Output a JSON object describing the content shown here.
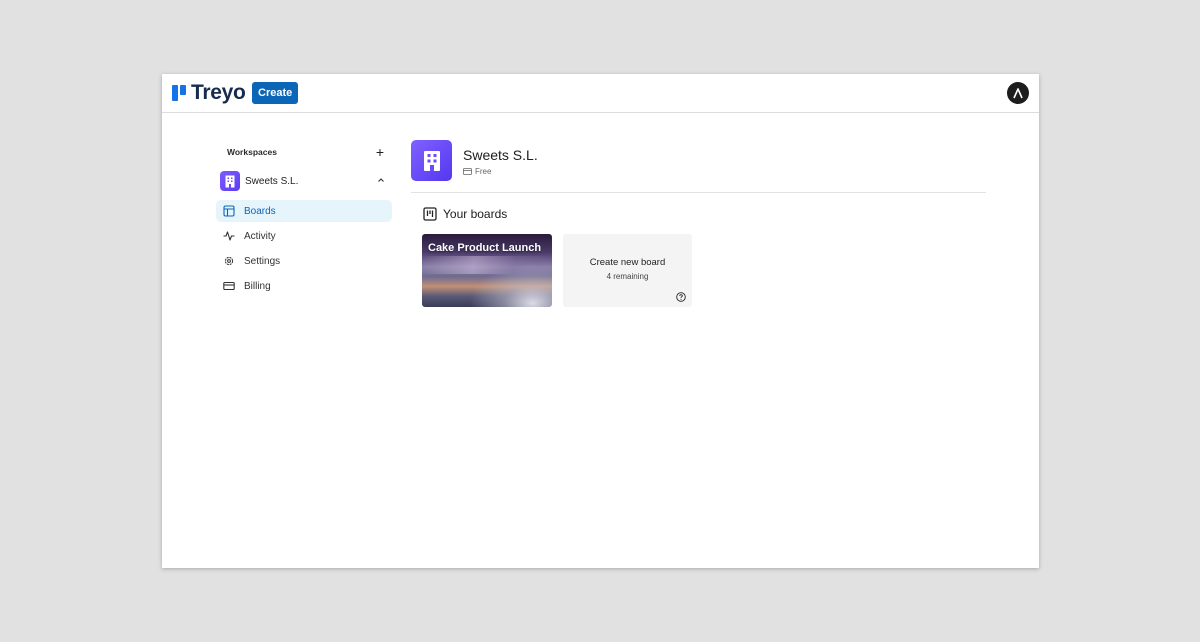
{
  "app": {
    "name": "Treyo",
    "brand_color": "#1473e6"
  },
  "topbar": {
    "create_label": "Create"
  },
  "sidebar": {
    "header_label": "Workspaces",
    "workspace": {
      "name": "Sweets S.L."
    },
    "items": [
      {
        "label": "Boards",
        "icon": "board-icon",
        "active": true
      },
      {
        "label": "Activity",
        "icon": "activity-icon",
        "active": false
      },
      {
        "label": "Settings",
        "icon": "gear-icon",
        "active": false
      },
      {
        "label": "Billing",
        "icon": "credit-card-icon",
        "active": false
      }
    ]
  },
  "main": {
    "org_name": "Sweets S.L.",
    "plan": "Free",
    "section_title": "Your boards",
    "boards": [
      {
        "title": "Cake Product Launch"
      }
    ],
    "create_board": {
      "title": "Create new board",
      "remaining": "4 remaining"
    }
  }
}
